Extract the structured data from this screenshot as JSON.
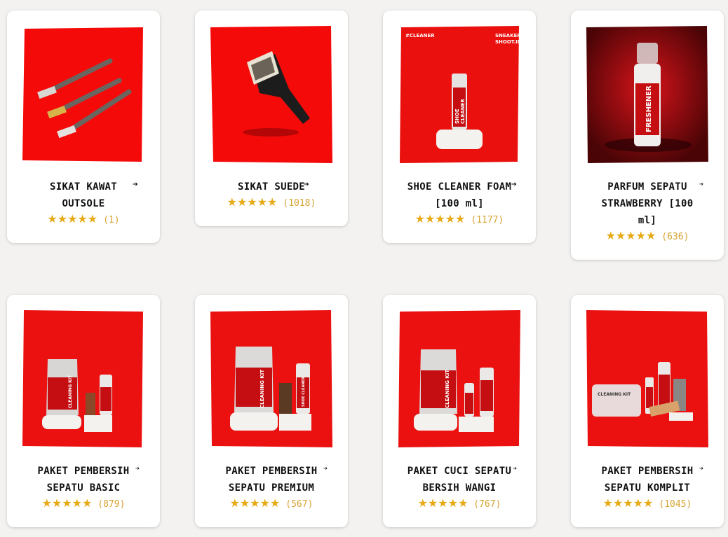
{
  "accent_star_color": "#e7a914",
  "product_bg_color": "#e4110f",
  "products": [
    {
      "title_line1": "SIKAT KAWAT",
      "title_line2": "OUTSOLE",
      "title_line3": "",
      "stars": "★★★★★",
      "reviews": "(1)",
      "image": "wire-brushes-image",
      "arrow_icon": "arrow-circle-icon"
    },
    {
      "title_line1": "SIKAT SUEDE",
      "title_line2": "",
      "title_line3": "",
      "stars": "★★★★★",
      "reviews": "(1018)",
      "image": "suede-brush-image",
      "arrow_icon": "arrow-circle-icon"
    },
    {
      "title_line1": "SHOE CLEANER FOAM",
      "title_line2": "[100 ml]",
      "title_line3": "",
      "stars": "★★★★★",
      "reviews": "(1177)",
      "image": "shoe-cleaner-image",
      "label_top_left": "#CLEANER",
      "label_top_right_1": "SNEAKER",
      "label_top_right_2": "SHOOT.ID",
      "bottle_text_1": "SHOE",
      "bottle_text_2": "CLEANER",
      "arrow_icon": "arrow-circle-icon"
    },
    {
      "title_line1": "PARFUM SEPATU",
      "title_line2": "STRAWBERRY [100",
      "title_line3": "ml]",
      "stars": "★★★★★",
      "reviews": "(636)",
      "image": "freshener-image",
      "bottle_text_1": "FRESHENER",
      "arrow_icon": "arrow-circle-icon"
    },
    {
      "title_line1": "PAKET PEMBERSIH",
      "title_line2": "SEPATU BASIC",
      "title_line3": "",
      "stars": "★★★★★",
      "reviews": "(879)",
      "image": "basic-kit-image",
      "pouch_text": "CLEANING KIT",
      "arrow_icon": "arrow-circle-icon"
    },
    {
      "title_line1": "PAKET PEMBERSIH",
      "title_line2": "SEPATU PREMIUM",
      "title_line3": "",
      "stars": "★★★★★",
      "reviews": "(567)",
      "image": "premium-kit-image",
      "pouch_text": "CLEANING KIT",
      "bottle_text_1": "SHOE CLEANER",
      "arrow_icon": "arrow-circle-icon"
    },
    {
      "title_line1": "PAKET CUCI SEPATU",
      "title_line2": "BERSIH WANGI",
      "title_line3": "",
      "stars": "★★★★★",
      "reviews": "(767)",
      "image": "wangi-kit-image",
      "pouch_text": "CLEANING KIT",
      "arrow_icon": "arrow-circle-icon"
    },
    {
      "title_line1": "PAKET PEMBERSIH",
      "title_line2": "SEPATU KOMPLIT",
      "title_line3": "",
      "stars": "★★★★★",
      "reviews": "(1045)",
      "image": "komplit-kit-image",
      "box_text": "CLEANING KIT",
      "arrow_icon": "arrow-circle-icon"
    }
  ]
}
